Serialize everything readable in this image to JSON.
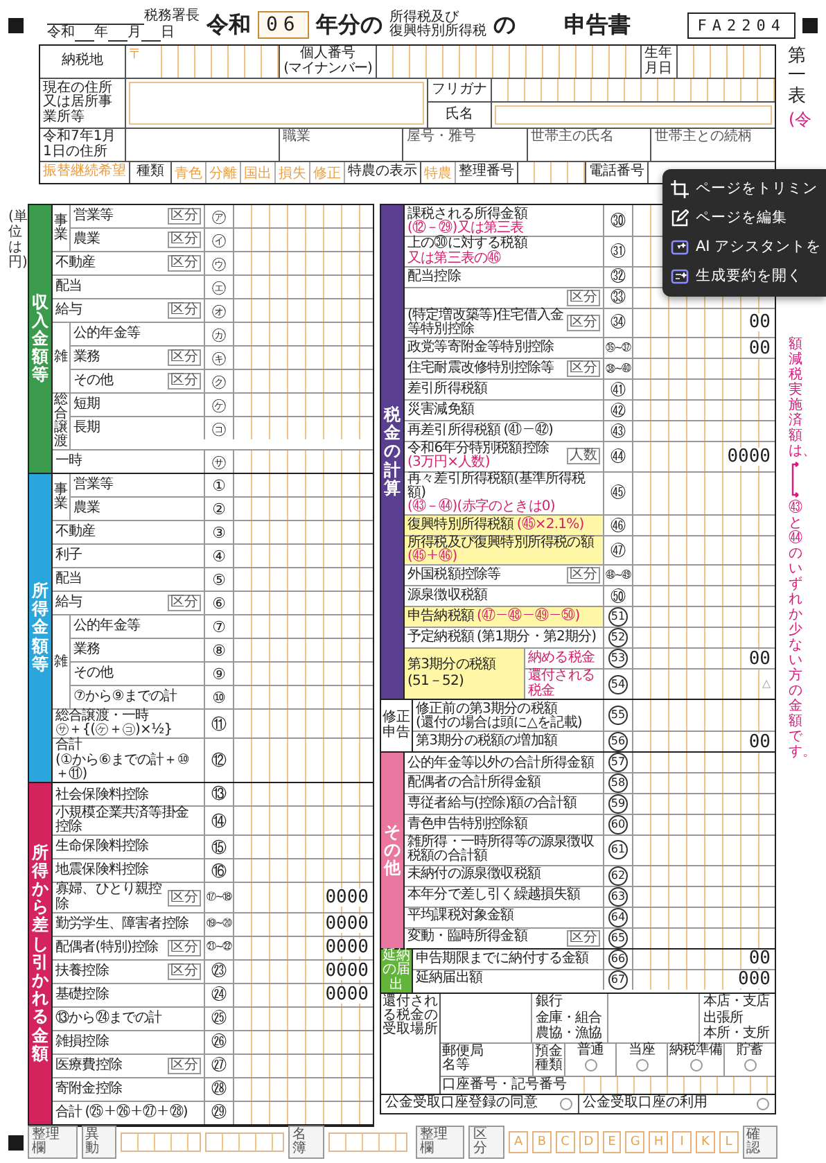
{
  "header": {
    "office_suffix": "税務署長",
    "date_parts": [
      "令和",
      "年",
      "月",
      "日"
    ],
    "era": "令和",
    "year": "06",
    "year_suffix": "年分の",
    "tax_names": [
      "所得税及び",
      "復興特別所得税"
    ],
    "joiner": "の",
    "title": "申告書",
    "form_code": "FA2204"
  },
  "sheet": {
    "label": "第一表",
    "note": "(令"
  },
  "unit_note": "(単位は円)",
  "identity": {
    "address_label": "納税地",
    "postal_mark": "〒",
    "mynumber_label": "個人番号",
    "mynumber_sub": "(マイナンバー)",
    "birth_label": "生年月日",
    "current_address_label": "現在の住所又は居所事業所等",
    "furigana_label": "フリガナ",
    "name_label": "氏名",
    "jan1_address_label": "令和7年1月1日の住所",
    "occupation_label": "職業",
    "trade_name_label": "屋号・雅号",
    "householder_label": "世帯主の氏名",
    "relation_label": "世帯主との続柄"
  },
  "types_row": {
    "transfer_label": "振替継続希望",
    "type_label": "種類",
    "types": [
      "青色",
      "分離",
      "国出",
      "損失",
      "修正"
    ],
    "special_label": "特農の表示",
    "special": "特農",
    "ref_label": "整理番号",
    "phone_label": "電話番号"
  },
  "left_sections": [
    {
      "title": "収入金額等",
      "color": "#3a9b4c",
      "rows": [
        {
          "group": "事業",
          "kind": "vertical",
          "rows": [
            {
              "label": "営業等",
              "num": "㋐",
              "division": "区分"
            },
            {
              "label": "農業",
              "num": "㋑",
              "division": "区分"
            }
          ]
        },
        {
          "label": "不動産",
          "num": "㋒",
          "division": "区分"
        },
        {
          "label": "配当",
          "num": "㋓"
        },
        {
          "label": "給与",
          "num": "㋔",
          "division": "区分"
        },
        {
          "group": "雑",
          "kind": "vertical",
          "rows": [
            {
              "label": "公的年金等",
              "num": "㋕"
            },
            {
              "label": "業務",
              "num": "㋖",
              "division": "区分"
            },
            {
              "label": "その他",
              "num": "㋗",
              "division": "区分"
            }
          ]
        },
        {
          "group": "総合譲渡",
          "kind": "vertical",
          "rows": [
            {
              "label": "短期",
              "num": "㋘"
            },
            {
              "label": "長期",
              "num": "㋙"
            }
          ]
        },
        {
          "label": "一時",
          "num": "㋚"
        }
      ]
    },
    {
      "title": "所得金額等",
      "color": "#2aa6dc",
      "rows": [
        {
          "group": "事業",
          "kind": "vertical",
          "rows": [
            {
              "label": "営業等",
              "num": "①"
            },
            {
              "label": "農業",
              "num": "②"
            }
          ]
        },
        {
          "label": "不動産",
          "num": "③"
        },
        {
          "label": "利子",
          "num": "④"
        },
        {
          "label": "配当",
          "num": "⑤"
        },
        {
          "label": "給与",
          "num": "⑥",
          "division": "区分"
        },
        {
          "group": "雑",
          "kind": "vertical",
          "rows": [
            {
              "label": "公的年金等",
              "num": "⑦"
            },
            {
              "label": "業務",
              "num": "⑧"
            },
            {
              "label": "その他",
              "num": "⑨"
            },
            {
              "label": "⑦から⑨までの計",
              "num": "⑩"
            }
          ]
        },
        {
          "label": "総合譲渡・一時",
          "sub": "㋚＋{(㋘＋㋙)×½}",
          "num": "⑪"
        },
        {
          "label": "合計",
          "sub": "(①から⑥までの計＋⑩＋⑪)",
          "num": "⑫"
        }
      ]
    },
    {
      "title": "所得から差し引かれる金額",
      "color": "#d4245e",
      "rows": [
        {
          "label": "社会保険料控除",
          "num": "⑬"
        },
        {
          "label": "小規模企業共済等掛金控除",
          "num": "⑭"
        },
        {
          "label": "生命保険料控除",
          "num": "⑮"
        },
        {
          "label": "地震保険料控除",
          "num": "⑯"
        },
        {
          "label": "寡婦、ひとり親控除",
          "division": "区分",
          "num": "⑰~⑱",
          "kind": "range",
          "filled": "0000"
        },
        {
          "label": "勤労学生、障害者控除",
          "num": "⑲~⑳",
          "kind": "range",
          "filled": "0000"
        },
        {
          "label": "配偶者(特別)控除",
          "division": "区分",
          "num": "㉑~㉒",
          "kind": "range",
          "filled": "0000"
        },
        {
          "label": "扶養控除",
          "division": "区分",
          "num": "㉓",
          "filled": "0000"
        },
        {
          "label": "基礎控除",
          "num": "㉔",
          "filled": "0000"
        },
        {
          "label": "⑬から㉔までの計",
          "num": "㉕"
        },
        {
          "label": "雑損控除",
          "num": "㉖"
        },
        {
          "label": "医療費控除",
          "division": "区分",
          "num": "㉗"
        },
        {
          "label": "寄附金控除",
          "num": "㉘"
        },
        {
          "label": "合計",
          "sub": "(㉕＋㉖＋㉗＋㉘)",
          "num": "㉙"
        }
      ]
    }
  ],
  "right_sections": [
    {
      "title": "税金の計算",
      "color": "#5a3e90",
      "rows": [
        {
          "label": "課税される所得金額",
          "sub": "(⑫－㉙)又は第三表",
          "sub_accent": true,
          "num": "㉚"
        },
        {
          "label": "上の㉚に対する税額",
          "sub": "又は第三表の㊻",
          "sub_accent": true,
          "num": "㉛"
        },
        {
          "label": "配当控除",
          "num": "㉜"
        },
        {
          "division": "区分",
          "num": "㉝"
        },
        {
          "label": "(特定増改築等)住宅借入金等特別控除",
          "division": "区分",
          "num": "㉞",
          "filled": "00"
        },
        {
          "label": "政党等寄附金等特別控除",
          "num": "㉟~㊲",
          "kind": "range",
          "filled": "00"
        },
        {
          "label": "住宅耐震改修特別控除等",
          "division": "区分",
          "num": "㊳~㊵",
          "kind": "range"
        },
        {
          "label": "差引所得税額",
          "num": "㊶"
        },
        {
          "label": "災害減免額",
          "num": "㊷"
        },
        {
          "label": "再差引所得税額",
          "sub": "(㊶－㊷)",
          "num": "㊸"
        },
        {
          "label": "令和6年分特別税額控除",
          "sub": "(3万円×人数)",
          "sub_accent": true,
          "division": "人数",
          "num": "㊹",
          "filled": "0000"
        },
        {
          "label": "再々差引所得税額(基準所得税額)",
          "sub": "(㊸－㊹)(赤字のときは0)",
          "sub_accent": true,
          "num": "㊺"
        },
        {
          "label": "復興特別所得税額",
          "sub": "(㊺×2.1%)",
          "sub_accent": true,
          "highlight": true,
          "num": "㊻"
        },
        {
          "label": "所得税及び復興特別所得税の額",
          "sub": "(㊺＋㊻)",
          "sub_accent": true,
          "highlight": true,
          "num": "㊼"
        },
        {
          "label": "外国税額控除等",
          "division": "区分",
          "num": "㊽~㊾",
          "kind": "range"
        },
        {
          "label": "源泉徴収税額",
          "num": "㊿"
        },
        {
          "label": "申告納税額",
          "sub": "(㊼－㊽－㊾－㊿)",
          "sub_accent": true,
          "highlight": true,
          "num": "51",
          "kind": "ring"
        },
        {
          "label": "予定納税額",
          "sub": "(第1期分・第2期分)",
          "num": "52",
          "kind": "ring"
        },
        {
          "group": "第3期分の税額",
          "sub": "(51－52)",
          "kind": "block",
          "highlight": true,
          "rows": [
            {
              "label": "納める税金",
              "label_accent": true,
              "num": "53",
              "kind": "ring",
              "filled": "00"
            },
            {
              "label": "還付される税金",
              "label_accent": true,
              "num": "54",
              "kind": "ring",
              "placeholder": "△"
            }
          ]
        }
      ]
    },
    {
      "title": "修正申告",
      "color": "#ffffff",
      "small_title": true,
      "rows": [
        {
          "label": "修正前の第3期分の税額",
          "sub": "(還付の場合は頭に△を記載)",
          "num": "55",
          "kind": "ring"
        },
        {
          "label": "第3期分の税額の増加額",
          "num": "56",
          "kind": "ring",
          "filled": "00"
        }
      ]
    },
    {
      "title": "その他",
      "color": "#e9779f",
      "rows": [
        {
          "label": "公的年金等以外の合計所得金額",
          "num": "57",
          "kind": "ring"
        },
        {
          "label": "配偶者の合計所得金額",
          "num": "58",
          "kind": "ring"
        },
        {
          "label": "専従者給与(控除)額の合計額",
          "num": "59",
          "kind": "ring"
        },
        {
          "label": "青色申告特別控除額",
          "num": "60",
          "kind": "ring"
        },
        {
          "label": "雑所得・一時所得等の源泉徴収税額の合計額",
          "num": "61",
          "kind": "ring"
        },
        {
          "label": "未納付の源泉徴収税額",
          "num": "62",
          "kind": "ring"
        },
        {
          "label": "本年分で差し引く繰越損失額",
          "num": "63",
          "kind": "ring"
        },
        {
          "label": "平均課税対象金額",
          "num": "64",
          "kind": "ring"
        },
        {
          "label": "変動・臨時所得金額",
          "division": "区分",
          "num": "65",
          "kind": "ring"
        }
      ]
    },
    {
      "title": "延納の届出",
      "color": "#63b43a",
      "small_title": true,
      "rows": [
        {
          "label": "申告期限までに納付する金額",
          "num": "66",
          "kind": "ring",
          "filled": "00"
        },
        {
          "label": "延納届出額",
          "num": "67",
          "kind": "ring",
          "filled": "000"
        }
      ]
    }
  ],
  "refund": {
    "title": "還付される税金の受取場所",
    "bank_types": [
      "銀行",
      "金庫・組合",
      "農協・漁協"
    ],
    "branch_types": [
      "本店・支店",
      "出張所",
      "本所・支所"
    ],
    "post_label": "郵便局名等",
    "deposit_label": "預金種類",
    "deposit_types": [
      {
        "label": "普通",
        "selected": false
      },
      {
        "label": "当座",
        "selected": false
      },
      {
        "label": "納税準備",
        "selected": false
      },
      {
        "label": "貯蓄",
        "selected": false
      }
    ],
    "account_label": "口座番号・記号番号"
  },
  "public_account": [
    {
      "label": "公金受取口座登録の同意",
      "checked": false
    },
    {
      "label": "公金受取口座の利用",
      "checked": false
    }
  ],
  "footer": {
    "left": [
      "整理欄",
      "異動",
      "名簿"
    ],
    "right_labels": [
      "整理欄",
      "区分"
    ],
    "letters": [
      "A",
      "B",
      "C",
      "D",
      "E",
      "G",
      "H",
      "I",
      "K",
      "L"
    ],
    "confirm": "確認"
  },
  "side_note": {
    "top": "額減税実施済額は、",
    "bottom": "㊸と㊹のいずれか少ない方の金額です。"
  },
  "context_menu": [
    {
      "label": "ページをトリミン",
      "kind": "crop"
    },
    {
      "label": "ページを編集",
      "kind": "edit"
    },
    {
      "label": "AI アシスタントを",
      "kind": "assistant"
    },
    {
      "label": "生成要約を開く",
      "kind": "summary"
    }
  ]
}
